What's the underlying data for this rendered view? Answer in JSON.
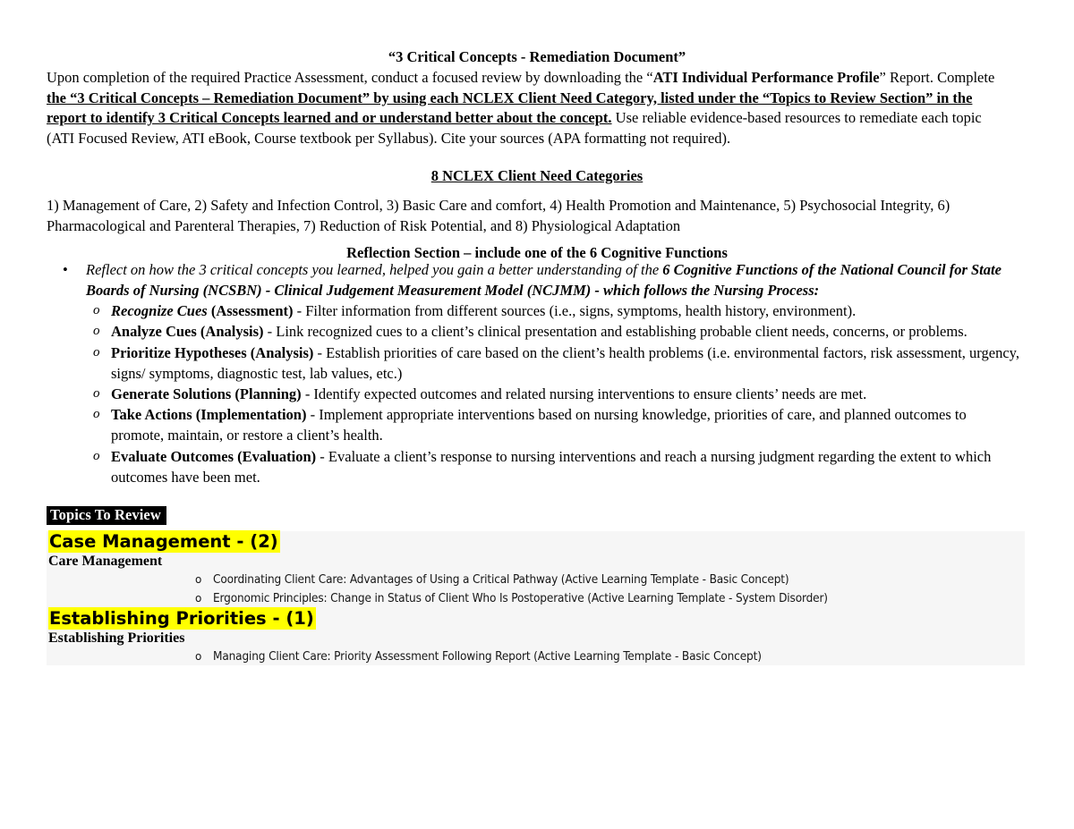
{
  "document": {
    "title": "“3 Critical Concepts - Remediation Document”",
    "intro": {
      "part1": "Upon completion of the required Practice Assessment, conduct a focused review by downloading the “",
      "bold1": "ATI Individual Performance Profile",
      "part2": "” Report. Complete ",
      "boldunderline": "the “3 Critical Concepts – Remediation Document” by using each NCLEX Client Need Category, listed under the “Topics to Review Section” in the report to identify 3 Critical Concepts learned and or understand better about the concept.",
      "part3": "  Use reliable evidence-based resources to remediate each topic (ATI Focused Review, ATI eBook, Course textbook per Syllabus). Cite your sources (APA formatting not required)."
    },
    "categories_heading": "8 NCLEX Client Need Categories",
    "categories_text": "1) Management of Care, 2) Safety and Infection Control, 3) Basic Care and comfort, 4) Health Promotion and Maintenance, 5) Psychosocial Integrity, 6) Pharmacological and Parenteral Therapies, 7) Reduction of Risk Potential, and 8) Physiological Adaptation",
    "reflection_heading": "Reflection Section – include one of the 6 Cognitive Functions",
    "reflection_bullet": {
      "italic_lead": "Reflect on how the 3 critical concepts you learned, helped you gain a better understanding of the ",
      "bold_italic": "6 Cognitive Functions of the National Council for State Boards of Nursing (NCSBN) - Clinical Judgement Measurement Model (NCJMM) - which follows the Nursing Process:"
    },
    "cognitive_functions": [
      {
        "marker": "o",
        "term_italic": "Recognize Cues",
        "term_plain": " (Assessment)",
        "description": " - Filter information from different sources (i.e., signs, symptoms, health history, environment)."
      },
      {
        "marker": "o",
        "term_italic": "",
        "term_plain": "Analyze Cues (Analysis)",
        "description": " - Link recognized cues to a client’s clinical presentation and establishing probable client needs, concerns, or problems."
      },
      {
        "marker": "o",
        "term_italic": "",
        "term_plain": "Prioritize Hypotheses (Analysis)",
        "description": " - Establish priorities of care based on the client’s health problems (i.e. environmental factors, risk assessment, urgency, signs/ symptoms, diagnostic test, lab values, etc.)"
      },
      {
        "marker": "o",
        "term_italic": "",
        "term_plain": "Generate Solutions (Planning)",
        "description": " - Identify expected outcomes and related nursing interventions to ensure clients’ needs are met."
      },
      {
        "marker": "o",
        "term_italic": "",
        "term_plain": "Take Actions (Implementation)",
        "description": " - Implement appropriate interventions based on nursing knowledge, priorities of care, and planned outcomes to promote, maintain, or restore a client’s health."
      },
      {
        "marker": "o",
        "term_italic": "",
        "term_plain": "Evaluate Outcomes (Evaluation)",
        "description": " - Evaluate a client’s response to nursing interventions and reach a nursing judgment regarding the extent to which outcomes have been met."
      }
    ],
    "topics_badge": "Topics To Review",
    "topics": [
      {
        "heading": "Case Management - (2)",
        "subheading": "Care Management",
        "items": [
          {
            "marker": "o",
            "text": "Coordinating Client Care: Advantages of Using a Critical Pathway (Active Learning Template - Basic Concept)"
          },
          {
            "marker": "o",
            "text": "Ergonomic Principles: Change in Status of Client Who Is Postoperative (Active Learning Template - System Disorder)"
          }
        ]
      },
      {
        "heading": "Establishing Priorities - (1)",
        "subheading": "Establishing Priorities",
        "items": [
          {
            "marker": "o",
            "text": "Managing Client Care: Priority Assessment Following Report (Active Learning Template - Basic Concept)"
          }
        ]
      }
    ],
    "colors": {
      "highlight": "#ffff00",
      "panel_background": "#f6f6f6",
      "badge_background": "#000000",
      "badge_text": "#ffffff",
      "text": "#000000"
    }
  }
}
